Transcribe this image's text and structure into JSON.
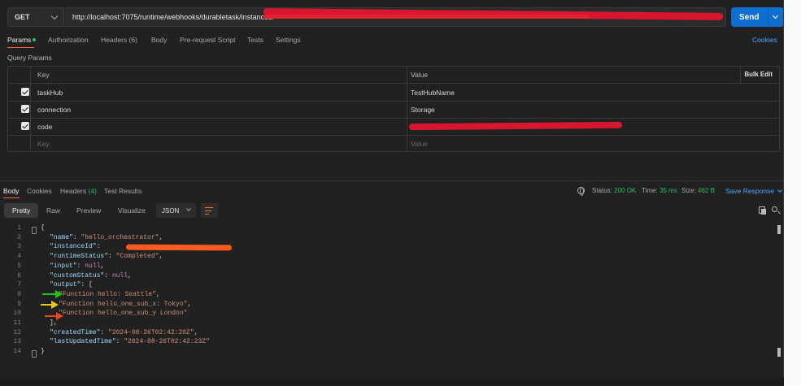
{
  "request": {
    "method": "GET",
    "url": "http://localhost:7075/runtime/webhooks/durabletask/instances/",
    "send_label": "Send"
  },
  "request_tabs": [
    {
      "label": "Params"
    },
    {
      "label": "Authorization"
    },
    {
      "label": "Headers (6)"
    },
    {
      "label": "Body"
    },
    {
      "label": "Pre-request Script"
    },
    {
      "label": "Tests"
    },
    {
      "label": "Settings"
    }
  ],
  "cookies_label": "Cookies",
  "query_params_label": "Query Params",
  "params_table": {
    "key_header": "Key",
    "value_header": "Value",
    "bulk_edit_label": "Bulk Edit",
    "rows": [
      {
        "key": "taskHub",
        "value": "TestHubName"
      },
      {
        "key": "connection",
        "value": "Storage"
      },
      {
        "key": "code",
        "value": ""
      }
    ],
    "placeholder_key": "Key",
    "placeholder_value": "Value"
  },
  "response_tabs": {
    "body": "Body",
    "cookies": "Cookies",
    "headers": "Headers",
    "headers_count": "(4)",
    "test_results": "Test Results"
  },
  "response_meta": {
    "status_label": "Status:",
    "status_value": "200 OK",
    "time_label": "Time:",
    "time_value": "35 ms",
    "size_label": "Size:",
    "size_value": "462 B",
    "save_label": "Save Response"
  },
  "format_toolbar": {
    "pretty": "Pretty",
    "raw": "Raw",
    "preview": "Preview",
    "visualize": "Visualize",
    "format": "JSON"
  },
  "code_lines": [
    {
      "n": "1",
      "text": "{"
    },
    {
      "n": "2",
      "key": "\"name\"",
      "val": "\"hello_orchestrator\"",
      "tail": ","
    },
    {
      "n": "3",
      "key": "\"instanceId\"",
      "val": "",
      "tail": ","
    },
    {
      "n": "4",
      "key": "\"runtimeStatus\"",
      "val": "\"Completed\"",
      "tail": ","
    },
    {
      "n": "5",
      "key": "\"input\"",
      "nul": "null",
      "tail": ","
    },
    {
      "n": "6",
      "key": "\"customStatus\"",
      "nul": "null",
      "tail": ","
    },
    {
      "n": "7",
      "key": "\"output\"",
      "tail": "["
    },
    {
      "n": "8",
      "val": "\"Function hello: Seattle\"",
      "tail": ","
    },
    {
      "n": "9",
      "val": "\"Function hello_one_sub_x: Tokyo\"",
      "tail": ","
    },
    {
      "n": "10",
      "val": "\"Function hello_one_sub_y London\""
    },
    {
      "n": "11",
      "text": "],"
    },
    {
      "n": "12",
      "key": "\"createdTime\"",
      "val": "\"2024-08-26T02:42:20Z\"",
      "tail": ","
    },
    {
      "n": "13",
      "key": "\"lastUpdatedTime\"",
      "val": "\"2024-08-26T02:42:23Z\""
    },
    {
      "n": "14",
      "text": "}"
    }
  ],
  "arrow_colors": {
    "line8": "#22c41f",
    "line9": "#e6c818",
    "line10": "#e6461c"
  }
}
